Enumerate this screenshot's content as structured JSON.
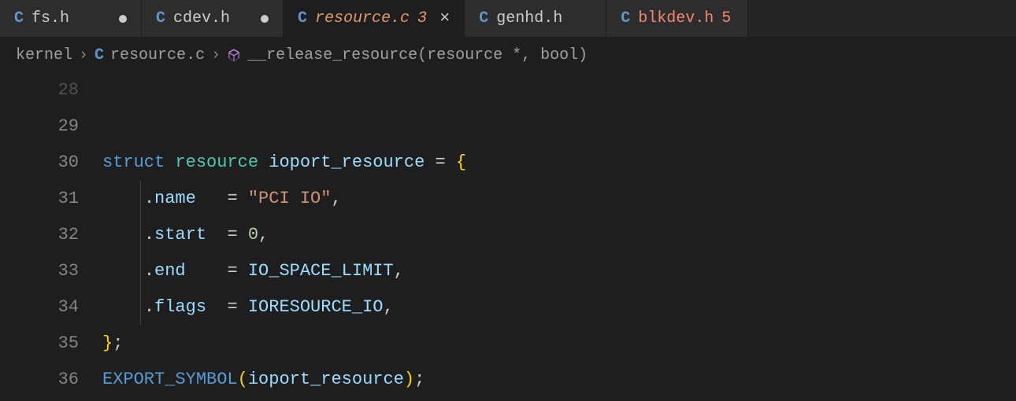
{
  "tabs": [
    {
      "icon": "C",
      "label": "fs.h",
      "dirty": true,
      "active": false
    },
    {
      "icon": "C",
      "label": "cdev.h",
      "dirty": true,
      "active": false
    },
    {
      "icon": "C",
      "label": "resource.c",
      "badge": "3",
      "active": true,
      "closable": true
    },
    {
      "icon": "C",
      "label": "genhd.h",
      "active": false
    },
    {
      "icon": "C",
      "label": "blkdev.h",
      "badge": "5",
      "active": false,
      "badgeRed": true
    }
  ],
  "breadcrumb": {
    "parts": [
      {
        "text": "kernel"
      },
      {
        "icon": "C",
        "text": "resource.c"
      },
      {
        "icon": "cube",
        "text": "__release_resource(resource *, bool)"
      }
    ]
  },
  "code": {
    "startLine": 28,
    "lines": [
      {
        "num": "28",
        "faded": true,
        "tokens": []
      },
      {
        "num": "29",
        "tokens": []
      },
      {
        "num": "30",
        "tokens": [
          {
            "t": "struct",
            "c": "kw"
          },
          {
            "t": " "
          },
          {
            "t": "resource",
            "c": "type"
          },
          {
            "t": " "
          },
          {
            "t": "ioport_resource",
            "c": "var"
          },
          {
            "t": " "
          },
          {
            "t": "=",
            "c": "punct"
          },
          {
            "t": " "
          },
          {
            "t": "{",
            "c": "brace"
          }
        ]
      },
      {
        "num": "31",
        "guide": true,
        "indent": "    ",
        "tokens": [
          {
            "t": ".",
            "c": "punct"
          },
          {
            "t": "name",
            "c": "field"
          },
          {
            "t": "   ",
            "c": ""
          },
          {
            "t": "=",
            "c": "punct"
          },
          {
            "t": " "
          },
          {
            "t": "\"PCI IO\"",
            "c": "str"
          },
          {
            "t": ",",
            "c": "punct"
          }
        ]
      },
      {
        "num": "32",
        "guide": true,
        "indent": "    ",
        "tokens": [
          {
            "t": ".",
            "c": "punct"
          },
          {
            "t": "start",
            "c": "field"
          },
          {
            "t": "  ",
            "c": ""
          },
          {
            "t": "=",
            "c": "punct"
          },
          {
            "t": " "
          },
          {
            "t": "0",
            "c": "num"
          },
          {
            "t": ",",
            "c": "punct"
          }
        ]
      },
      {
        "num": "33",
        "guide": true,
        "indent": "    ",
        "tokens": [
          {
            "t": ".",
            "c": "punct"
          },
          {
            "t": "end",
            "c": "field"
          },
          {
            "t": "    ",
            "c": ""
          },
          {
            "t": "=",
            "c": "punct"
          },
          {
            "t": " "
          },
          {
            "t": "IO_SPACE_LIMIT",
            "c": "const"
          },
          {
            "t": ",",
            "c": "punct"
          }
        ]
      },
      {
        "num": "34",
        "guide": true,
        "indent": "    ",
        "tokens": [
          {
            "t": ".",
            "c": "punct"
          },
          {
            "t": "flags",
            "c": "field"
          },
          {
            "t": "  ",
            "c": ""
          },
          {
            "t": "=",
            "c": "punct"
          },
          {
            "t": " "
          },
          {
            "t": "IORESOURCE_IO",
            "c": "const"
          },
          {
            "t": ",",
            "c": "punct"
          }
        ]
      },
      {
        "num": "35",
        "tokens": [
          {
            "t": "}",
            "c": "brace"
          },
          {
            "t": ";",
            "c": "punct"
          }
        ]
      },
      {
        "num": "36",
        "tokens": [
          {
            "t": "EXPORT_SYMBOL",
            "c": "func"
          },
          {
            "t": "(",
            "c": "brace"
          },
          {
            "t": "ioport_resource",
            "c": "var"
          },
          {
            "t": ")",
            "c": "brace"
          },
          {
            "t": ";",
            "c": "punct"
          }
        ]
      }
    ]
  }
}
